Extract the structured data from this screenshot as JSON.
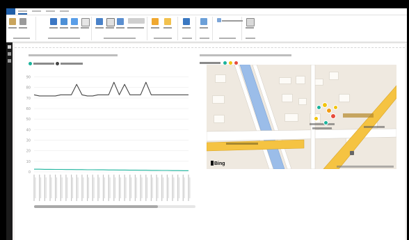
{
  "window": {
    "file_tab": "",
    "tabs": [
      "",
      "",
      "",
      "",
      ""
    ]
  },
  "ribbon": {
    "groups": [
      "",
      "",
      "",
      "",
      "",
      "",
      "",
      "",
      ""
    ],
    "buttons": [
      "",
      "",
      "",
      "",
      "",
      "",
      "",
      "",
      "",
      "",
      "",
      "",
      "",
      "",
      "",
      "",
      "",
      "",
      "",
      ""
    ]
  },
  "visuals": {
    "left_title": "",
    "right_title": "",
    "left_legend": [
      "",
      ""
    ],
    "right_legend": [
      "",
      "",
      "",
      ""
    ]
  },
  "map": {
    "attribution": "Bing",
    "copyright": ""
  },
  "colors": {
    "ribbon_accent": "#1f5ea8",
    "series_1": "#1bb39c",
    "series_2": "#444444",
    "map_road_yellow": "#f5c342",
    "map_water": "#8fb4e6",
    "legend_colors": [
      "#1bb39c",
      "#f1c40f",
      "#e67e22",
      "#e74c3c"
    ]
  },
  "chart_data": {
    "type": "line",
    "title": "",
    "xlabel": "",
    "ylabel": "",
    "ylim": [
      0,
      95
    ],
    "yticks": [
      0,
      10,
      20,
      30,
      40,
      50,
      60,
      70,
      80,
      90
    ],
    "x": [
      1,
      2,
      3,
      4,
      5,
      6,
      7,
      8,
      9,
      10,
      11,
      12,
      13,
      14,
      15,
      16,
      17,
      18,
      19,
      20,
      21,
      22,
      23,
      24,
      25,
      26,
      27,
      28,
      29,
      30
    ],
    "series": [
      {
        "name": "",
        "color": "#444444",
        "values": [
          73,
          72,
          72,
          72,
          72,
          73,
          73,
          73,
          83,
          73,
          72,
          72,
          73,
          73,
          73,
          85,
          73,
          83,
          73,
          73,
          73,
          85,
          73,
          73,
          73,
          73,
          73,
          73,
          73,
          73
        ]
      },
      {
        "name": "",
        "color": "#1bb39c",
        "values": [
          2.5,
          2.5,
          2.4,
          2.4,
          2.3,
          2.3,
          2.2,
          2.2,
          2.1,
          2.1,
          2.0,
          2.0,
          1.9,
          1.9,
          1.8,
          1.8,
          1.7,
          1.7,
          1.6,
          1.6,
          1.5,
          1.5,
          1.4,
          1.4,
          1.3,
          1.3,
          1.2,
          1.2,
          1.1,
          1.1
        ]
      }
    ]
  }
}
